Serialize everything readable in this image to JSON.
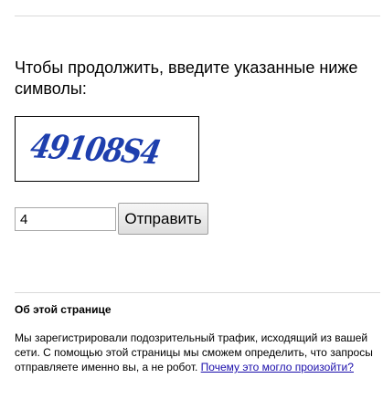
{
  "page": {
    "heading": "Чтобы продолжить, введите указанные ниже символы:"
  },
  "captcha": {
    "text": "49108S4",
    "color": "#1e3fae"
  },
  "form": {
    "input_value": "4",
    "submit_label": "Отправить"
  },
  "about": {
    "title": "Об этой странице",
    "text": "Мы зарегистрировали подозрительный трафик, исходящий из вашей сети. С помощью этой страницы мы сможем определить, что запросы отправляете именно вы, а не робот. ",
    "link_text": "Почему это могло произойти?"
  },
  "colors": {
    "link": "#1a0dab",
    "rule": "#d9d9d9"
  }
}
